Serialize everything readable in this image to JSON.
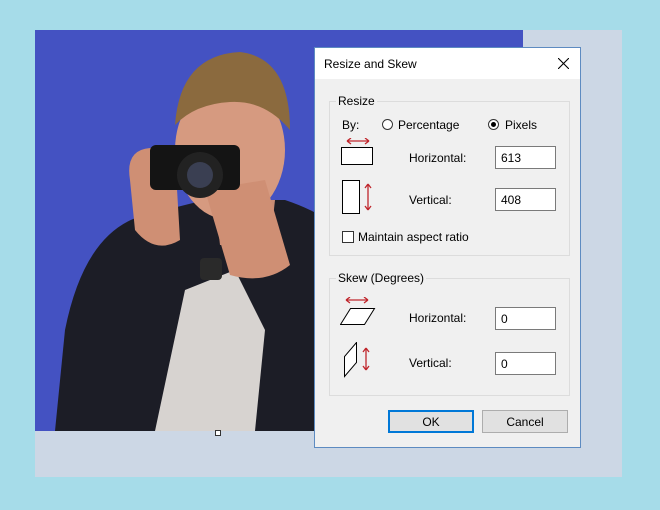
{
  "dialog": {
    "title": "Resize and Skew",
    "resize": {
      "group_label": "Resize",
      "by_label": "By:",
      "options": [
        "Percentage",
        "Pixels"
      ],
      "selected_option": "Pixels",
      "horizontal_label": "Horizontal:",
      "horizontal_value": "613",
      "vertical_label": "Vertical:",
      "vertical_value": "408",
      "maintain_aspect_label": "Maintain aspect ratio",
      "maintain_aspect_checked": false
    },
    "skew": {
      "group_label": "Skew (Degrees)",
      "horizontal_label": "Horizontal:",
      "horizontal_value": "0",
      "vertical_label": "Vertical:",
      "vertical_value": "0"
    },
    "ok_label": "OK",
    "cancel_label": "Cancel"
  },
  "icons": {
    "close": "close-icon",
    "resize_horizontal": "resize-horizontal-icon",
    "resize_vertical": "resize-vertical-icon",
    "skew_horizontal": "skew-horizontal-icon",
    "skew_vertical": "skew-vertical-icon"
  },
  "colors": {
    "page_background": "#a6dce9",
    "canvas_background": "#4452c2",
    "dialog_border": "#5d8bc1",
    "arrow_red": "#c0262c",
    "default_button_border": "#0078d7"
  }
}
